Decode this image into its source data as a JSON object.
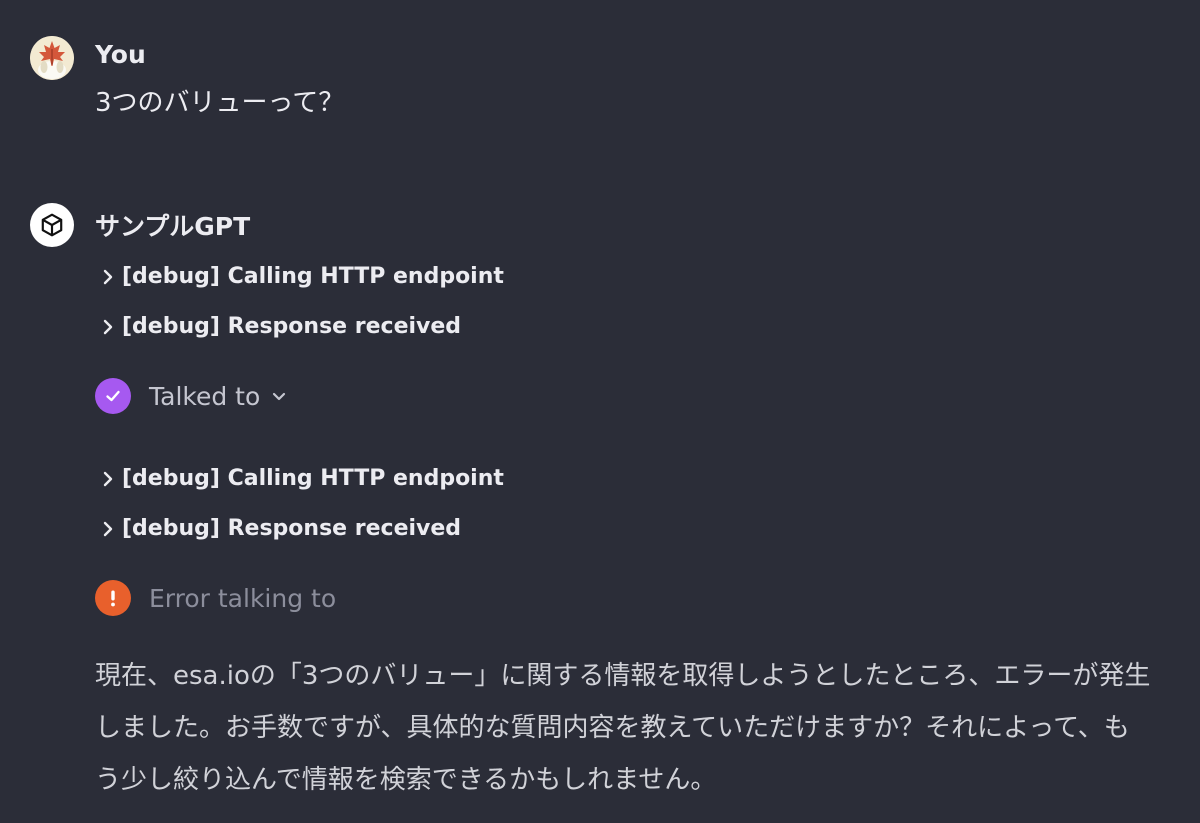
{
  "user": {
    "name": "You",
    "avatar_icon": "maple-leaf-avatar",
    "message": "3つのバリューって？"
  },
  "assistant": {
    "name": "サンプルGPT",
    "avatar_icon": "cube-icon",
    "debug_group_1": [
      "[debug] Calling HTTP endpoint",
      "[debug] Response received"
    ],
    "status_1": {
      "label": "Talked to",
      "icon": "check-icon",
      "color": "#a659f0"
    },
    "debug_group_2": [
      "[debug] Calling HTTP endpoint",
      "[debug] Response received"
    ],
    "status_2": {
      "label": "Error talking to",
      "icon": "exclamation-icon",
      "color": "#e8602c"
    },
    "reply": "現在、esa.ioの「3つのバリュー」に関する情報を取得しようとしたところ、エラーが発生しました。お手数ですが、具体的な質問内容を教えていただけますか？それによって、もう少し絞り込んで情報を検索できるかもしれません。"
  }
}
